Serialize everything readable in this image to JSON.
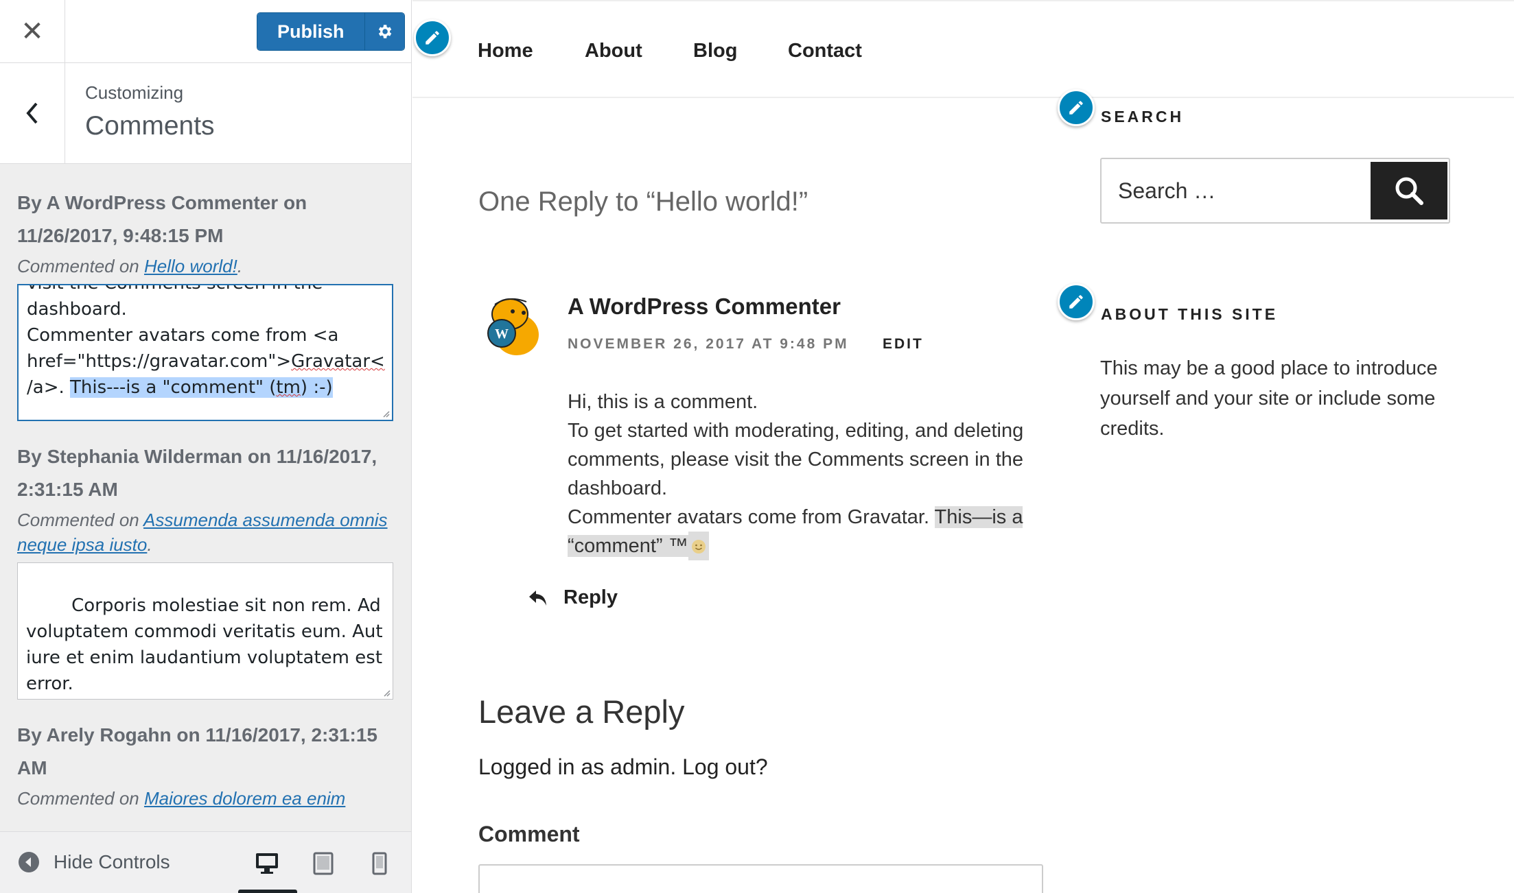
{
  "customizer": {
    "publish_label": "Publish",
    "customizing_label": "Customizing",
    "section_title": "Comments",
    "comments": [
      {
        "meta": "By A WordPress Commenter on 11/26/2017, 9:48:15 PM",
        "commented_on_prefix": "Commented on ",
        "post_title": "Hello world!",
        "text_before": "visit the Comments screen in the\ndashboard.\nCommenter avatars come from <a\nhref=\"https://gravatar.com\">",
        "text_misspelled": "Gravatar<",
        "text_middle": "\n/a>. ",
        "text_selected_1": "This---is a \"comment\" (",
        "text_selected_misspelled": "tm",
        "text_selected_2": ") :-)"
      },
      {
        "meta": "By Stephania Wilderman on 11/16/2017, 2:31:15 AM",
        "commented_on_prefix": "Commented on ",
        "post_title": "Assumenda assumenda omnis neque ipsa iusto",
        "text": "Corporis molestiae sit non rem. Ad voluptatem commodi veritatis eum. Aut iure et enim laudantium voluptatem est error."
      },
      {
        "meta": "By Arely Rogahn on 11/16/2017, 2:31:15 AM",
        "commented_on_prefix": "Commented on ",
        "post_title": "Maiores dolorem ea enim"
      }
    ],
    "hide_controls_label": "Hide Controls",
    "devices": [
      "desktop-icon",
      "tablet-icon",
      "mobile-icon"
    ]
  },
  "site": {
    "nav": [
      "Home",
      "About",
      "Blog",
      "Contact"
    ],
    "replies_title": "One Reply to “Hello world!”",
    "comment": {
      "author": "A WordPress Commenter",
      "date": "NOVEMBER 26, 2017 AT 9:48 PM",
      "edit_label": "EDIT",
      "line1": "Hi, this is a comment.",
      "line2": "To get started with moderating, editing, and deleting comments, please visit the Comments screen in the dashboard.",
      "line3_prefix": "Commenter avatars come from Gravatar. ",
      "line3_highlight": "This—is a “comment” ™",
      "reply_label": "Reply"
    },
    "leave_reply_title": "Leave a Reply",
    "logged_in_text": "Logged in as admin. Log out?",
    "comment_field_label": "Comment",
    "search_widget_title": "SEARCH",
    "search_placeholder": "Search …",
    "about_widget_title": "ABOUT THIS SITE",
    "about_text": "This may be a good place to introduce yourself and your site or include some credits."
  },
  "colors": {
    "accent": "#2271b1",
    "edit_shortcut": "#0085ba",
    "sidebar_bg": "#eeeeee"
  }
}
